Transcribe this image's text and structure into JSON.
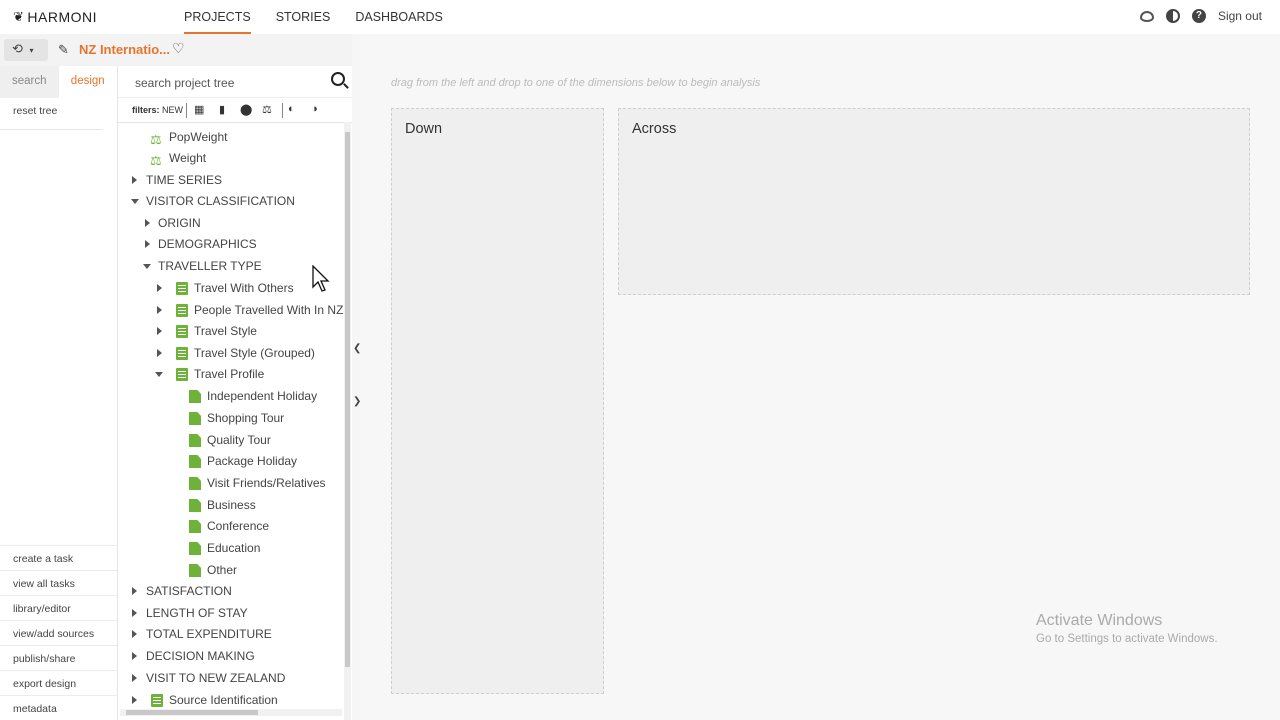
{
  "brand": "HARMONI",
  "nav": {
    "projects": "PROJECTS",
    "stories": "STORIES",
    "dashboards": "DASHBOARDS"
  },
  "top_right": {
    "sign_out": "Sign out"
  },
  "subbar": {
    "project_name": "NZ Internatio..."
  },
  "left_tabs": {
    "search": "search",
    "design": "design"
  },
  "reset_tree": "reset tree",
  "bottom_links": [
    "create a task",
    "view all tasks",
    "library/editor",
    "view/add sources",
    "publish/share",
    "export design",
    "metadata"
  ],
  "tree_search": {
    "placeholder": "search project tree"
  },
  "filters": {
    "label": "filters:",
    "new": "NEW"
  },
  "tree": {
    "popweight": "PopWeight",
    "weight": "Weight",
    "time_series": "TIME SERIES",
    "visitor_classification": "VISITOR CLASSIFICATION",
    "origin": "ORIGIN",
    "demographics": "DEMOGRAPHICS",
    "traveller_type": "TRAVELLER TYPE",
    "travel_with_others": "Travel With Others",
    "people_travelled": "People Travelled With In NZ",
    "travel_style": "Travel Style",
    "travel_style_grouped": "Travel Style (Grouped)",
    "travel_profile": "Travel Profile",
    "profile_items": [
      "Independent Holiday",
      "Shopping Tour",
      "Quality Tour",
      "Package Holiday",
      "Visit Friends/Relatives",
      "Business",
      "Conference",
      "Education",
      "Other"
    ],
    "satisfaction": "SATISFACTION",
    "length_of_stay": "LENGTH OF STAY",
    "total_expenditure": "TOTAL EXPENDITURE",
    "decision_making": "DECISION MAKING",
    "visit_to_nz": "VISIT TO NEW ZEALAND",
    "source_identification": "Source Identification"
  },
  "main": {
    "hint": "drag from the left and drop to one of the dimensions below to begin analysis",
    "down": "Down",
    "across": "Across"
  },
  "watermark": {
    "line1": "Activate Windows",
    "line2": "Go to Settings to activate Windows."
  },
  "colors": {
    "accent": "#e8742b",
    "variable_green": "#6fb23a"
  }
}
